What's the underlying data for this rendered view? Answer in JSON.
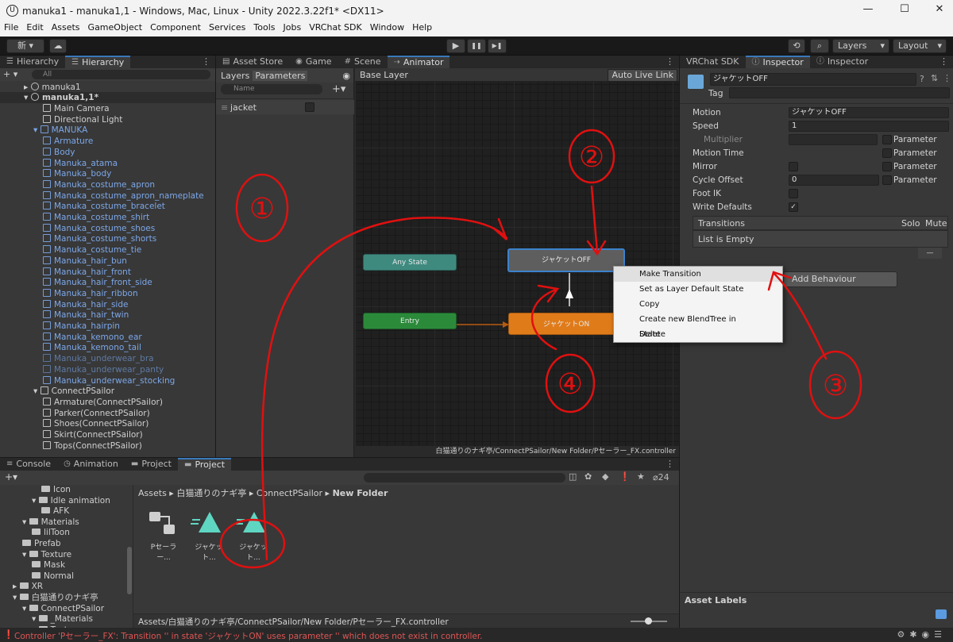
{
  "window": {
    "title": "manuka1 - manuka1,1 - Windows, Mac, Linux - Unity 2022.3.22f1* <DX11>",
    "logo": "U",
    "minimize": "—",
    "maximize": "☐",
    "close": "✕"
  },
  "menu": [
    "File",
    "Edit",
    "Assets",
    "GameObject",
    "Component",
    "Services",
    "Tools",
    "Jobs",
    "VRChat SDK",
    "Window",
    "Help"
  ],
  "toolbar": {
    "account": "新 ▾",
    "cloud_icon": "☁",
    "play": "▶",
    "pause": "❚❚",
    "step": "▶❚",
    "history_icon": "⟲",
    "search_icon": "⌕",
    "layers": "Layers",
    "layout": "Layout"
  },
  "hierarchy": {
    "tabs": [
      "Hierarchy",
      "Hierarchy"
    ],
    "search_placeholder": "All",
    "add": "+ ▾",
    "scenes": [
      "manuka1",
      "manuka1,1*"
    ],
    "items": [
      {
        "label": "Main Camera",
        "style": "gray",
        "depth": 2
      },
      {
        "label": "Directional Light",
        "style": "gray",
        "depth": 2
      },
      {
        "label": "MANUKA",
        "style": "blue",
        "depth": 1
      },
      {
        "label": "Armature",
        "style": "blue",
        "depth": 2
      },
      {
        "label": "Body",
        "style": "blue",
        "depth": 2
      },
      {
        "label": "Manuka_atama",
        "style": "blue",
        "depth": 2
      },
      {
        "label": "Manuka_body",
        "style": "blue",
        "depth": 2
      },
      {
        "label": "Manuka_costume_apron",
        "style": "blue",
        "depth": 2
      },
      {
        "label": "Manuka_costume_apron_nameplate",
        "style": "blue",
        "depth": 2
      },
      {
        "label": "Manuka_costume_bracelet",
        "style": "blue",
        "depth": 2
      },
      {
        "label": "Manuka_costume_shirt",
        "style": "blue",
        "depth": 2
      },
      {
        "label": "Manuka_costume_shoes",
        "style": "blue",
        "depth": 2
      },
      {
        "label": "Manuka_costume_shorts",
        "style": "blue",
        "depth": 2
      },
      {
        "label": "Manuka_costume_tie",
        "style": "blue",
        "depth": 2
      },
      {
        "label": "Manuka_hair_bun",
        "style": "blue",
        "depth": 2
      },
      {
        "label": "Manuka_hair_front",
        "style": "blue",
        "depth": 2
      },
      {
        "label": "Manuka_hair_front_side",
        "style": "blue",
        "depth": 2
      },
      {
        "label": "Manuka_hair_ribbon",
        "style": "blue",
        "depth": 2
      },
      {
        "label": "Manuka_hair_side",
        "style": "blue",
        "depth": 2
      },
      {
        "label": "Manuka_hair_twin",
        "style": "blue",
        "depth": 2
      },
      {
        "label": "Manuka_hairpin",
        "style": "blue",
        "depth": 2
      },
      {
        "label": "Manuka_kemono_ear",
        "style": "blue",
        "depth": 2
      },
      {
        "label": "Manuka_kemono_tail",
        "style": "blue",
        "depth": 2
      },
      {
        "label": "Manuka_underwear_bra",
        "style": "dim",
        "depth": 2
      },
      {
        "label": "Manuka_underwear_panty",
        "style": "dim",
        "depth": 2
      },
      {
        "label": "Manuka_underwear_stocking",
        "style": "blue",
        "depth": 2
      },
      {
        "label": "ConnectPSailor",
        "style": "gray",
        "depth": 1
      },
      {
        "label": "Armature(ConnectPSailor)",
        "style": "gray",
        "depth": 2
      },
      {
        "label": "Parker(ConnectPSailor)",
        "style": "gray",
        "depth": 2
      },
      {
        "label": "Shoes(ConnectPSailor)",
        "style": "gray",
        "depth": 2
      },
      {
        "label": "Skirt(ConnectPSailor)",
        "style": "gray",
        "depth": 2
      },
      {
        "label": "Tops(ConnectPSailor)",
        "style": "gray",
        "depth": 2
      }
    ]
  },
  "center_tabs": [
    "Asset Store",
    "Game",
    "Scene",
    "Animator"
  ],
  "animator": {
    "subtabs": [
      "Layers",
      "Parameters"
    ],
    "name_placeholder": "Name",
    "param": "jacket",
    "breadcrumb": "Base Layer",
    "auto_live_link": "Auto Live Link",
    "nodes": {
      "any_state": "Any State",
      "entry": "Entry",
      "jacket_off": "ジャケットOFF",
      "jacket_on": "ジャケットON"
    },
    "footer_path": "白猫通りのナギ亭/ConnectPSailor/New Folder/Pセーラー_FX.controller"
  },
  "context_menu": [
    "Make Transition",
    "Set as Layer Default State",
    "Copy",
    "Create new BlendTree in State",
    "Delete"
  ],
  "inspector": {
    "tabs": [
      "VRChat SDK",
      "Inspector",
      "Inspector"
    ],
    "object_name": "ジャケットOFF",
    "tag_label": "Tag",
    "rows": [
      {
        "label": "Motion",
        "value": "ジャケットOFF"
      },
      {
        "label": "Speed",
        "value": "1"
      },
      {
        "label": "Multiplier",
        "value": ""
      },
      {
        "label": "Motion Time",
        "value": ""
      },
      {
        "label": "Mirror",
        "value": ""
      },
      {
        "label": "Cycle Offset",
        "value": "0"
      },
      {
        "label": "Foot IK",
        "value": ""
      },
      {
        "label": "Write Defaults",
        "value": "✓"
      }
    ],
    "parameter_label": "Parameter",
    "transitions_header": "Transitions",
    "solo": "Solo",
    "mute": "Mute",
    "list_empty": "List is Empty",
    "minus": "—",
    "add_behaviour": "Add Behaviour",
    "asset_labels": "Asset Labels"
  },
  "bottom_tabs": [
    "Console",
    "Animation",
    "Project",
    "Project"
  ],
  "project": {
    "tree": [
      {
        "label": "Icon",
        "depth": 3
      },
      {
        "label": "Idle animation",
        "depth": 2
      },
      {
        "label": "AFK",
        "depth": 3
      },
      {
        "label": "Materials",
        "depth": 1
      },
      {
        "label": "lilToon",
        "depth": 2
      },
      {
        "label": "Prefab",
        "depth": 1
      },
      {
        "label": "Texture",
        "depth": 1
      },
      {
        "label": "Mask",
        "depth": 2
      },
      {
        "label": "Normal",
        "depth": 2
      },
      {
        "label": "XR",
        "depth": 0
      },
      {
        "label": "白猫通りのナギ亭",
        "depth": 0
      },
      {
        "label": "ConnectPSailor",
        "depth": 1
      },
      {
        "label": "_Materials",
        "depth": 2
      },
      {
        "label": "Texture",
        "depth": 2
      }
    ],
    "breadcrumb": [
      "Assets",
      "白猫通りのナギ亭",
      "ConnectPSailor",
      "New Folder"
    ],
    "assets": [
      "Pセーラー...",
      "ジャケット...",
      "ジャケット..."
    ],
    "hidden_count": "24",
    "footer_path": "Assets/白猫通りのナギ亭/ConnectPSailor/New Folder/Pセーラー_FX.controller"
  },
  "status": {
    "error": "Controller 'Pセーラー_FX': Transition '' in state 'ジャケットON' uses parameter '' which does not exist in controller."
  },
  "annotations": [
    "①",
    "②",
    "③",
    "④"
  ]
}
